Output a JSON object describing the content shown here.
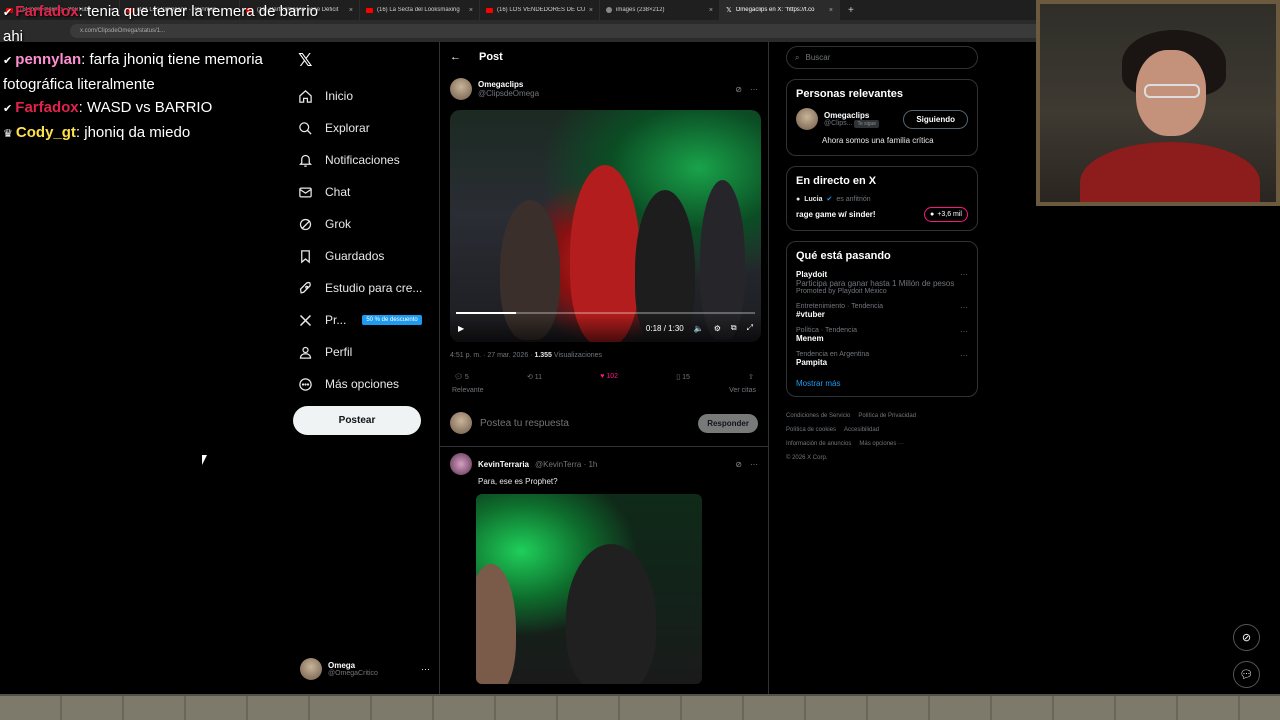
{
  "browser": {
    "tabs": [
      {
        "title": "(16) looksmaxing - YouTube",
        "icon": "youtube-icon",
        "active": false
      },
      {
        "title": "(16) Los Simpsons - Rainman",
        "icon": "youtube-icon",
        "active": false
      },
      {
        "title": "(16) Bart Simpson tiene Déficit",
        "icon": "youtube-icon",
        "active": false
      },
      {
        "title": "(16) La Secta del Looksmaxing",
        "icon": "youtube-icon",
        "active": false
      },
      {
        "title": "(16) LOS VENDEDORES DE CUR",
        "icon": "youtube-icon",
        "active": false
      },
      {
        "title": "images (238×212)",
        "icon": "globe-icon",
        "active": false
      },
      {
        "title": "Omegaclips en X: \"https://t.co",
        "icon": "x-icon",
        "active": true
      }
    ],
    "url": "x.com/ClipsdeOmega/status/1..."
  },
  "chat": [
    {
      "user": "Farfadox",
      "user_color": "#e0244b",
      "text": ": tenia que tener la remera de barrio ahi"
    },
    {
      "user": "pennylan",
      "user_color": "#ff8fd0",
      "text": ": farfa jhoniq tiene memoria fotográfica literalmente"
    },
    {
      "user": "Farfadox",
      "user_color": "#e0244b",
      "text": ": WASD vs BARRIO"
    },
    {
      "user": "Cody_gt",
      "user_color": "#ffe14a",
      "text": ": jhoniq da miedo"
    }
  ],
  "nav": {
    "items": [
      {
        "label": "Inicio",
        "icon": "home-icon"
      },
      {
        "label": "Explorar",
        "icon": "search-icon"
      },
      {
        "label": "Notificaciones",
        "icon": "bell-icon"
      },
      {
        "label": "Chat",
        "icon": "mail-icon"
      },
      {
        "label": "Grok",
        "icon": "grok-icon"
      },
      {
        "label": "Guardados",
        "icon": "bookmark-icon"
      },
      {
        "label": "Estudio para cre...",
        "icon": "rocket-icon"
      },
      {
        "label": "Pr...",
        "icon": "x-icon",
        "badge": "50 % de descuento"
      },
      {
        "label": "Perfil",
        "icon": "user-icon"
      },
      {
        "label": "Más opciones",
        "icon": "more-circle-icon"
      }
    ],
    "post_button": "Postear"
  },
  "account": {
    "name": "Omega",
    "handle": "@OmegaCritico"
  },
  "main": {
    "header": "Post",
    "tweet": {
      "name": "Omegaclips",
      "handle": "@ClipsdeOmega",
      "video_time": "0:18 / 1:30",
      "progress": 0.2,
      "timestamp": "4:51 p. m. · 27 mar. 2026 · ",
      "views": "1.355",
      "views_label": " Visualizaciones",
      "replies": "5",
      "reposts": "11",
      "likes": "102",
      "bookmarks": "15",
      "sort": "Relevante",
      "quotes": "Ver citas"
    },
    "reply_box": {
      "placeholder": "Postea tu respuesta",
      "button": "Responder"
    },
    "reply": {
      "name": "KevinTerraria",
      "handle": "@KevinTerra · 1h",
      "text": "Para, ese es Prophet?"
    }
  },
  "right": {
    "search_placeholder": "Buscar",
    "relevant": {
      "title": "Personas relevantes",
      "name": "Omegaclips",
      "handle": "@Clips...",
      "follows_you": "Te sigue",
      "button": "Siguiendo",
      "bio": "Ahora somos una familia crítica"
    },
    "live": {
      "title": "En directo en X",
      "host": "Lucia",
      "host_suffix": "es anfitrión",
      "stream_title": "rage game w/ sinder!",
      "viewers": "+3,6 mil"
    },
    "trends": {
      "title": "Qué está pasando",
      "items": [
        {
          "category": "",
          "name": "Playdoit",
          "desc": "Participa para ganar hasta 1 Millón de pesos",
          "promo": "Promoted by Playdoit México"
        },
        {
          "category": "Entretenimiento · Tendencia",
          "name": "#vtuber",
          "desc": "",
          "promo": ""
        },
        {
          "category": "Política · Tendencia",
          "name": "Menem",
          "desc": "",
          "promo": ""
        },
        {
          "category": "Tendencia en Argentina",
          "name": "Pampita",
          "desc": "",
          "promo": ""
        }
      ],
      "show_more": "Mostrar más"
    },
    "footer": [
      "Condiciones de Servicio",
      "Política de Privacidad",
      "Política de cookies",
      "Accesibilidad",
      "Información de anuncios",
      "Más opciones ···",
      "© 2026 X Corp."
    ]
  },
  "colors": {
    "accent": "#1d9bf0",
    "like": "#f91880",
    "background": "#000000"
  }
}
